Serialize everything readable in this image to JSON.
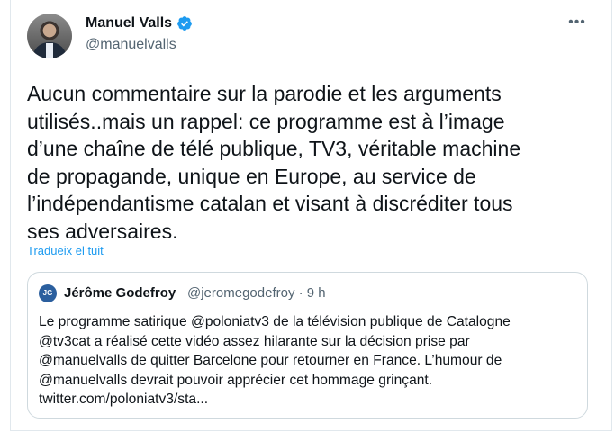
{
  "tweet": {
    "author_name": "Manuel Valls",
    "author_handle": "@manuelvalls",
    "verified_color": "#1d9bf0",
    "more_icon": "more-horizontal-icon",
    "text": "Aucun commentaire sur la parodie et les arguments\nutilisés..mais un rappel: ce programme est à l’image\nd’une chaîne de télé publique, TV3, véritable machine\nde propagande, unique en Europe, au service de\nl’indépendantisme catalan et visant à discréditer tous\nses adversaires.",
    "translate_label": "Tradueix el tuit"
  },
  "quoted": {
    "avatar_initials": "JG",
    "author_name": "Jérôme Godefroy",
    "author_handle_time": "@jeromegodefroy · 9 h",
    "text": "Le programme satirique @poloniatv3 de la télévision publique de Catalogne\n@tv3cat a réalisé cette vidéo assez hilarante sur la décision prise par\n@manuelvalls de quitter Barcelone pour retourner en France. L’humour de\n@manuelvalls devrait pouvoir apprécier cet hommage grinçant.\ntwitter.com/poloniatv3/sta..."
  },
  "colors": {
    "link": "#1d9bf0",
    "secondary_text": "#536471",
    "border": "#cfd9de"
  }
}
